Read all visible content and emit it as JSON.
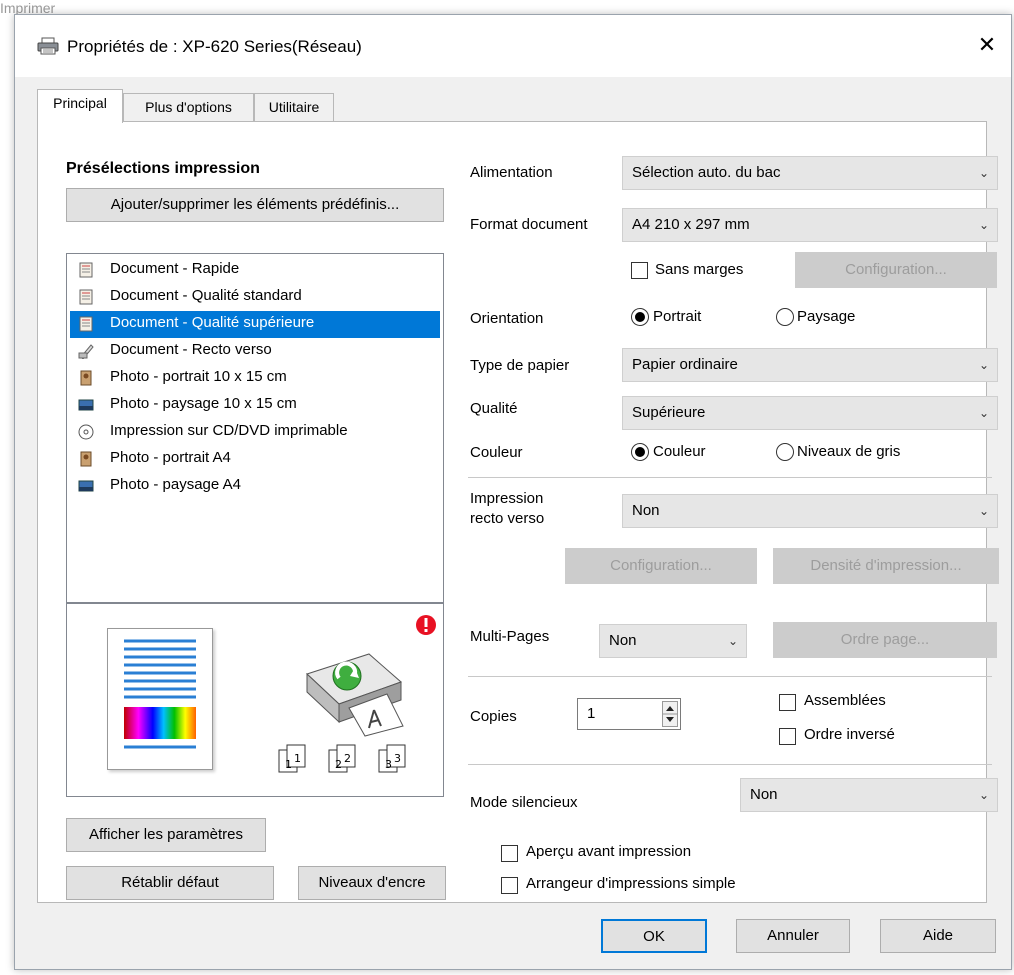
{
  "background_text": "Imprimer",
  "window": {
    "title": "Propriétés de : XP-620 Series(Réseau)",
    "close_glyph": "✕"
  },
  "tabs": [
    {
      "label": "Principal",
      "active": true
    },
    {
      "label": "Plus d'options",
      "active": false
    },
    {
      "label": "Utilitaire",
      "active": false
    }
  ],
  "presets": {
    "heading": "Présélections impression",
    "manage_button": "Ajouter/supprimer les éléments prédéfinis...",
    "items": [
      {
        "label": "Document - Rapide",
        "icon": "document-icon",
        "selected": false
      },
      {
        "label": "Document - Qualité standard",
        "icon": "document-icon",
        "selected": false
      },
      {
        "label": "Document - Qualité supérieure",
        "icon": "document-icon",
        "selected": true
      },
      {
        "label": "Document - Recto verso",
        "icon": "duplex-document-icon",
        "selected": false
      },
      {
        "label": "Photo - portrait 10 x 15 cm",
        "icon": "photo-portrait-icon",
        "selected": false
      },
      {
        "label": "Photo - paysage 10 x 15 cm",
        "icon": "photo-landscape-icon",
        "selected": false
      },
      {
        "label": "Impression sur CD/DVD imprimable",
        "icon": "cd-icon",
        "selected": false
      },
      {
        "label": "Photo - portrait A4",
        "icon": "photo-portrait-icon",
        "selected": false
      },
      {
        "label": "Photo - paysage A4",
        "icon": "photo-landscape-icon",
        "selected": false
      }
    ],
    "preview": {
      "warning_icon": "warning-icon",
      "page_numbers": [
        "1",
        "1",
        "2",
        "2",
        "3",
        "3"
      ]
    },
    "show_settings_button": "Afficher les paramètres",
    "reset_button": "Rétablir défaut",
    "ink_levels_button": "Niveaux d'encre"
  },
  "settings": {
    "paper_source": {
      "label": "Alimentation",
      "value": "Sélection auto. du bac"
    },
    "document_size": {
      "label": "Format document",
      "value": "A4 210 x 297 mm"
    },
    "borderless": {
      "label": "Sans marges",
      "checked": false
    },
    "borderless_config_button": "Configuration...",
    "orientation": {
      "label": "Orientation",
      "options": [
        "Portrait",
        "Paysage"
      ],
      "selected": "Portrait"
    },
    "paper_type": {
      "label": "Type de papier",
      "value": "Papier ordinaire"
    },
    "quality": {
      "label": "Qualité",
      "value": "Supérieure"
    },
    "color": {
      "label": "Couleur",
      "options": [
        "Couleur",
        "Niveaux de gris"
      ],
      "selected": "Couleur"
    },
    "duplex": {
      "label_line1": "Impression",
      "label_line2": "recto verso",
      "value": "Non"
    },
    "duplex_config_button": "Configuration...",
    "density_button": "Densité d'impression...",
    "multi_pages": {
      "label": "Multi-Pages",
      "value": "Non"
    },
    "page_order_button": "Ordre page...",
    "copies": {
      "label": "Copies",
      "value": "1"
    },
    "collate": {
      "label": "Assemblées",
      "checked": false
    },
    "reverse_order": {
      "label": "Ordre inversé",
      "checked": false
    },
    "quiet_mode": {
      "label": "Mode silencieux",
      "value": "Non"
    },
    "print_preview": {
      "label": "Aperçu avant impression",
      "checked": false
    },
    "job_arranger": {
      "label": "Arrangeur d'impressions simple",
      "checked": false
    }
  },
  "footer": {
    "ok": "OK",
    "cancel": "Annuler",
    "help": "Aide"
  },
  "colors": {
    "selection": "#0078d7",
    "dialog_bg": "#f0f0f0",
    "warning": "#e81123"
  }
}
